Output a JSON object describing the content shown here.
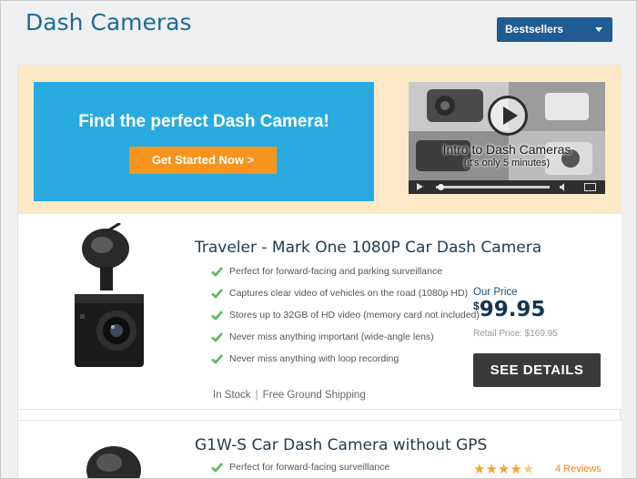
{
  "header": {
    "title": "Dash Cameras",
    "sort": {
      "selected": "Bestsellers"
    }
  },
  "promo": {
    "banner_text": "Find the perfect Dash Camera!",
    "banner_button": "Get Started Now  >",
    "video_title": "Intro to Dash Cameras",
    "video_subtitle": "(it's only 5 minutes)"
  },
  "products": [
    {
      "title": "Traveler - Mark One 1080P Car Dash Camera",
      "features": [
        "Perfect for forward-facing and parking surveillance",
        "Captures clear video of vehicles on the road (1080p HD)",
        "Stores up to 32GB of HD video (memory card not included)",
        "Never miss anything important (wide-angle lens)",
        "Never miss anything with loop recording"
      ],
      "price_label": "Our Price",
      "price_currency": "$",
      "price": "99.95",
      "retail_price": "Retail Price: $169.95",
      "button": "SEE DETAILS",
      "stock": "In Stock",
      "shipping": "Free Ground Shipping"
    },
    {
      "title": "G1W-S Car Dash Camera without GPS",
      "features": [
        "Perfect for forward-facing surveillance"
      ],
      "rating": 4.5,
      "reviews": "4 Reviews"
    }
  ],
  "colors": {
    "title_blue": "#1e6a97",
    "sort_bg": "#1e5c93",
    "promo_bg": "#fde9c7",
    "banner_bg": "#29abe2",
    "banner_button": "#f7941d",
    "check_green": "#5cb85c",
    "details_button": "#3a3a3a",
    "star": "#f1a52b"
  }
}
